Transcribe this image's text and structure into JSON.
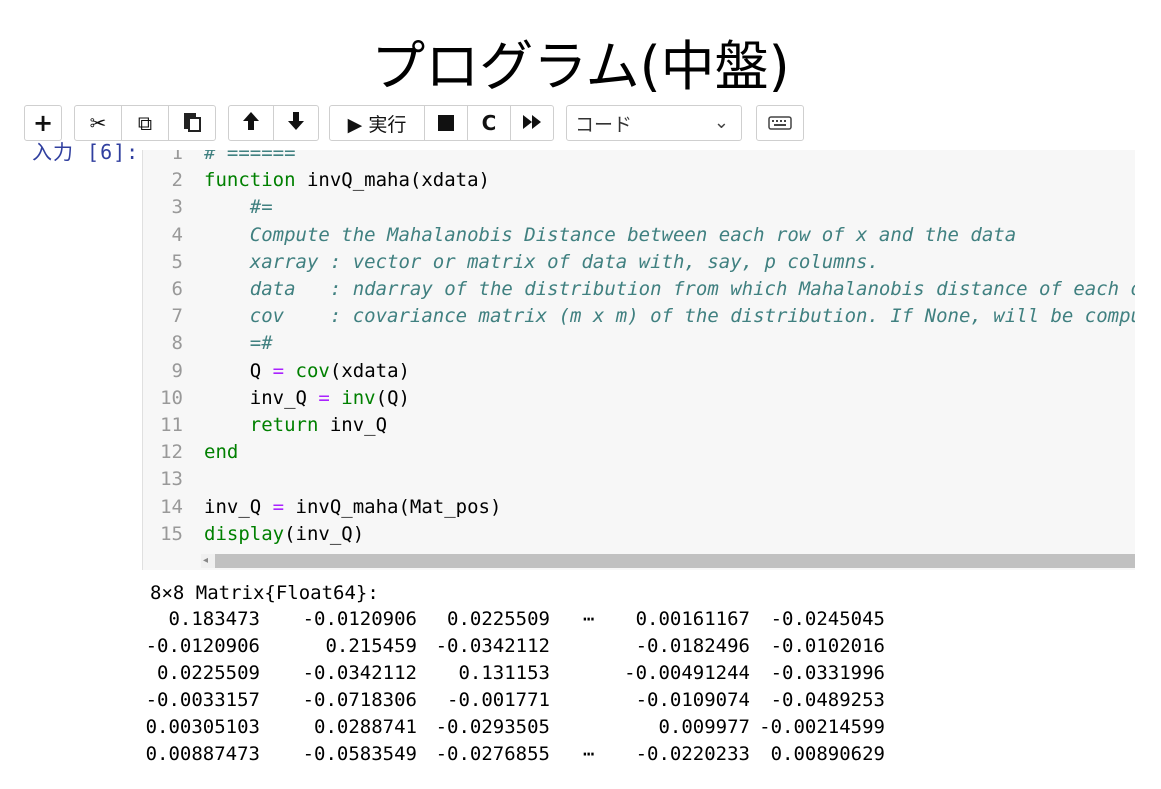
{
  "page_title": "プログラム(中盤)",
  "toolbar": {
    "add": "+",
    "cut": "✂",
    "copy": "⧉",
    "paste": "📋",
    "move_up": "🡅",
    "move_down": "🡇",
    "run_label": "▶ 実行",
    "stop": "■",
    "restart": "C",
    "fast_forward": "⏩",
    "cell_type_selected": "コード",
    "cell_type_caret": "⌄",
    "keyboard": "⌨"
  },
  "cell": {
    "prompt": "入力 [6]:",
    "line_numbers": [
      "1",
      "2",
      "3",
      "4",
      "5",
      "6",
      "7",
      "8",
      "9",
      "10",
      "11",
      "12",
      "13",
      "14",
      "15"
    ],
    "lines": [
      {
        "segments": [
          {
            "t": "# ======",
            "c": "cm"
          }
        ]
      },
      {
        "segments": [
          {
            "t": "function",
            "c": "kw"
          },
          {
            "t": " invQ_maha(xdata)",
            "c": ""
          }
        ]
      },
      {
        "segments": [
          {
            "t": "    #=",
            "c": "cm"
          }
        ]
      },
      {
        "segments": [
          {
            "t": "    Compute the Mahalanobis Distance between each row of x and the data",
            "c": "cm"
          }
        ]
      },
      {
        "segments": [
          {
            "t": "    xarray : vector or matrix of data with, say, p columns.",
            "c": "cm"
          }
        ]
      },
      {
        "segments": [
          {
            "t": "    data   : ndarray of the distribution from which Mahalanobis distance of each obs",
            "c": "cm"
          }
        ]
      },
      {
        "segments": [
          {
            "t": "    cov    : covariance matrix (m x m) of the distribution. If None, will be compute",
            "c": "cm"
          }
        ]
      },
      {
        "segments": [
          {
            "t": "    =#",
            "c": "cm"
          }
        ]
      },
      {
        "segments": [
          {
            "t": "    Q ",
            "c": ""
          },
          {
            "t": "=",
            "c": "op"
          },
          {
            "t": " ",
            "c": ""
          },
          {
            "t": "cov",
            "c": "kw"
          },
          {
            "t": "(xdata)",
            "c": ""
          }
        ]
      },
      {
        "segments": [
          {
            "t": "    inv_Q ",
            "c": ""
          },
          {
            "t": "=",
            "c": "op"
          },
          {
            "t": " ",
            "c": ""
          },
          {
            "t": "inv",
            "c": "kw"
          },
          {
            "t": "(Q)",
            "c": ""
          }
        ]
      },
      {
        "segments": [
          {
            "t": "    ",
            "c": ""
          },
          {
            "t": "return",
            "c": "kw"
          },
          {
            "t": " inv_Q",
            "c": ""
          }
        ]
      },
      {
        "segments": [
          {
            "t": "end",
            "c": "kw"
          }
        ]
      },
      {
        "segments": [
          {
            "t": "",
            "c": ""
          }
        ]
      },
      {
        "segments": [
          {
            "t": "inv_Q ",
            "c": ""
          },
          {
            "t": "=",
            "c": "op"
          },
          {
            "t": " invQ_maha(Mat_pos)",
            "c": ""
          }
        ]
      },
      {
        "segments": [
          {
            "t": "display",
            "c": "kw"
          },
          {
            "t": "(inv_Q)",
            "c": ""
          }
        ]
      }
    ],
    "scroll_arrow": "◂"
  },
  "output": {
    "header": "8×8 Matrix{Float64}:",
    "rows": [
      [
        "0.183473",
        "-0.0120906",
        "0.0225509",
        "⋯",
        "0.00161167",
        "-0.0245045"
      ],
      [
        "-0.0120906",
        "0.215459",
        "-0.0342112",
        "",
        "-0.0182496",
        "-0.0102016"
      ],
      [
        "0.0225509",
        "-0.0342112",
        "0.131153",
        "",
        "-0.00491244",
        "-0.0331996"
      ],
      [
        "-0.0033157",
        "-0.0718306",
        "-0.001771",
        "",
        "-0.0109074",
        "-0.0489253"
      ],
      [
        "0.00305103",
        "0.0288741",
        "-0.0293505",
        "",
        "0.009977",
        "-0.00214599"
      ],
      [
        "0.00887473",
        "-0.0583549",
        "-0.0276855",
        "⋯",
        "-0.0220233",
        "0.00890629"
      ]
    ]
  },
  "colors": {
    "keyword": "#008000",
    "comment": "#408080",
    "operator": "#aa22ff",
    "prompt": "#303f9f",
    "cell_bg": "#f7f7f7"
  }
}
